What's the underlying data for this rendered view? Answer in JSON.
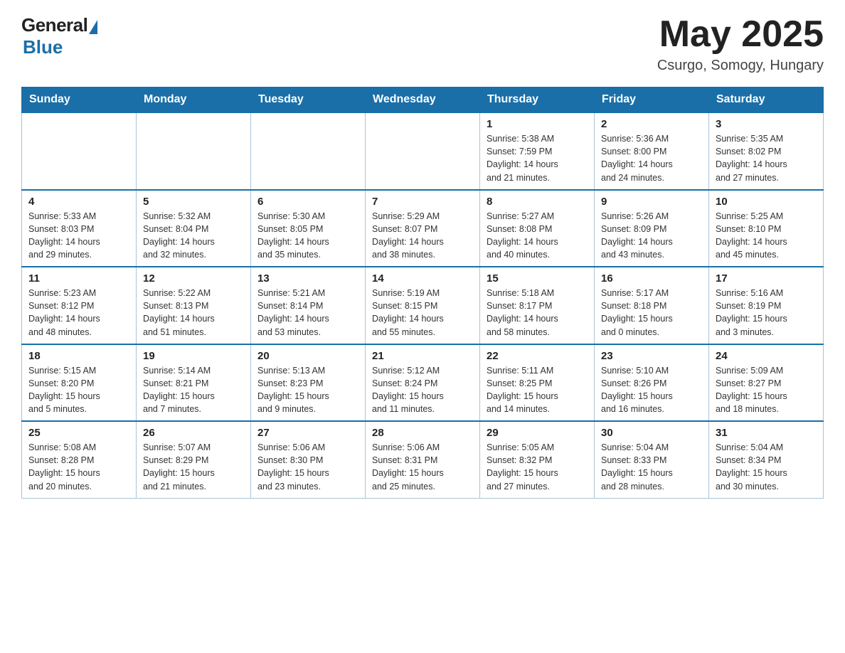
{
  "header": {
    "logo_general": "General",
    "logo_blue": "Blue",
    "title": "May 2025",
    "subtitle": "Csurgo, Somogy, Hungary"
  },
  "weekdays": [
    "Sunday",
    "Monday",
    "Tuesday",
    "Wednesday",
    "Thursday",
    "Friday",
    "Saturday"
  ],
  "weeks": [
    [
      {
        "day": "",
        "info": ""
      },
      {
        "day": "",
        "info": ""
      },
      {
        "day": "",
        "info": ""
      },
      {
        "day": "",
        "info": ""
      },
      {
        "day": "1",
        "info": "Sunrise: 5:38 AM\nSunset: 7:59 PM\nDaylight: 14 hours\nand 21 minutes."
      },
      {
        "day": "2",
        "info": "Sunrise: 5:36 AM\nSunset: 8:00 PM\nDaylight: 14 hours\nand 24 minutes."
      },
      {
        "day": "3",
        "info": "Sunrise: 5:35 AM\nSunset: 8:02 PM\nDaylight: 14 hours\nand 27 minutes."
      }
    ],
    [
      {
        "day": "4",
        "info": "Sunrise: 5:33 AM\nSunset: 8:03 PM\nDaylight: 14 hours\nand 29 minutes."
      },
      {
        "day": "5",
        "info": "Sunrise: 5:32 AM\nSunset: 8:04 PM\nDaylight: 14 hours\nand 32 minutes."
      },
      {
        "day": "6",
        "info": "Sunrise: 5:30 AM\nSunset: 8:05 PM\nDaylight: 14 hours\nand 35 minutes."
      },
      {
        "day": "7",
        "info": "Sunrise: 5:29 AM\nSunset: 8:07 PM\nDaylight: 14 hours\nand 38 minutes."
      },
      {
        "day": "8",
        "info": "Sunrise: 5:27 AM\nSunset: 8:08 PM\nDaylight: 14 hours\nand 40 minutes."
      },
      {
        "day": "9",
        "info": "Sunrise: 5:26 AM\nSunset: 8:09 PM\nDaylight: 14 hours\nand 43 minutes."
      },
      {
        "day": "10",
        "info": "Sunrise: 5:25 AM\nSunset: 8:10 PM\nDaylight: 14 hours\nand 45 minutes."
      }
    ],
    [
      {
        "day": "11",
        "info": "Sunrise: 5:23 AM\nSunset: 8:12 PM\nDaylight: 14 hours\nand 48 minutes."
      },
      {
        "day": "12",
        "info": "Sunrise: 5:22 AM\nSunset: 8:13 PM\nDaylight: 14 hours\nand 51 minutes."
      },
      {
        "day": "13",
        "info": "Sunrise: 5:21 AM\nSunset: 8:14 PM\nDaylight: 14 hours\nand 53 minutes."
      },
      {
        "day": "14",
        "info": "Sunrise: 5:19 AM\nSunset: 8:15 PM\nDaylight: 14 hours\nand 55 minutes."
      },
      {
        "day": "15",
        "info": "Sunrise: 5:18 AM\nSunset: 8:17 PM\nDaylight: 14 hours\nand 58 minutes."
      },
      {
        "day": "16",
        "info": "Sunrise: 5:17 AM\nSunset: 8:18 PM\nDaylight: 15 hours\nand 0 minutes."
      },
      {
        "day": "17",
        "info": "Sunrise: 5:16 AM\nSunset: 8:19 PM\nDaylight: 15 hours\nand 3 minutes."
      }
    ],
    [
      {
        "day": "18",
        "info": "Sunrise: 5:15 AM\nSunset: 8:20 PM\nDaylight: 15 hours\nand 5 minutes."
      },
      {
        "day": "19",
        "info": "Sunrise: 5:14 AM\nSunset: 8:21 PM\nDaylight: 15 hours\nand 7 minutes."
      },
      {
        "day": "20",
        "info": "Sunrise: 5:13 AM\nSunset: 8:23 PM\nDaylight: 15 hours\nand 9 minutes."
      },
      {
        "day": "21",
        "info": "Sunrise: 5:12 AM\nSunset: 8:24 PM\nDaylight: 15 hours\nand 11 minutes."
      },
      {
        "day": "22",
        "info": "Sunrise: 5:11 AM\nSunset: 8:25 PM\nDaylight: 15 hours\nand 14 minutes."
      },
      {
        "day": "23",
        "info": "Sunrise: 5:10 AM\nSunset: 8:26 PM\nDaylight: 15 hours\nand 16 minutes."
      },
      {
        "day": "24",
        "info": "Sunrise: 5:09 AM\nSunset: 8:27 PM\nDaylight: 15 hours\nand 18 minutes."
      }
    ],
    [
      {
        "day": "25",
        "info": "Sunrise: 5:08 AM\nSunset: 8:28 PM\nDaylight: 15 hours\nand 20 minutes."
      },
      {
        "day": "26",
        "info": "Sunrise: 5:07 AM\nSunset: 8:29 PM\nDaylight: 15 hours\nand 21 minutes."
      },
      {
        "day": "27",
        "info": "Sunrise: 5:06 AM\nSunset: 8:30 PM\nDaylight: 15 hours\nand 23 minutes."
      },
      {
        "day": "28",
        "info": "Sunrise: 5:06 AM\nSunset: 8:31 PM\nDaylight: 15 hours\nand 25 minutes."
      },
      {
        "day": "29",
        "info": "Sunrise: 5:05 AM\nSunset: 8:32 PM\nDaylight: 15 hours\nand 27 minutes."
      },
      {
        "day": "30",
        "info": "Sunrise: 5:04 AM\nSunset: 8:33 PM\nDaylight: 15 hours\nand 28 minutes."
      },
      {
        "day": "31",
        "info": "Sunrise: 5:04 AM\nSunset: 8:34 PM\nDaylight: 15 hours\nand 30 minutes."
      }
    ]
  ]
}
